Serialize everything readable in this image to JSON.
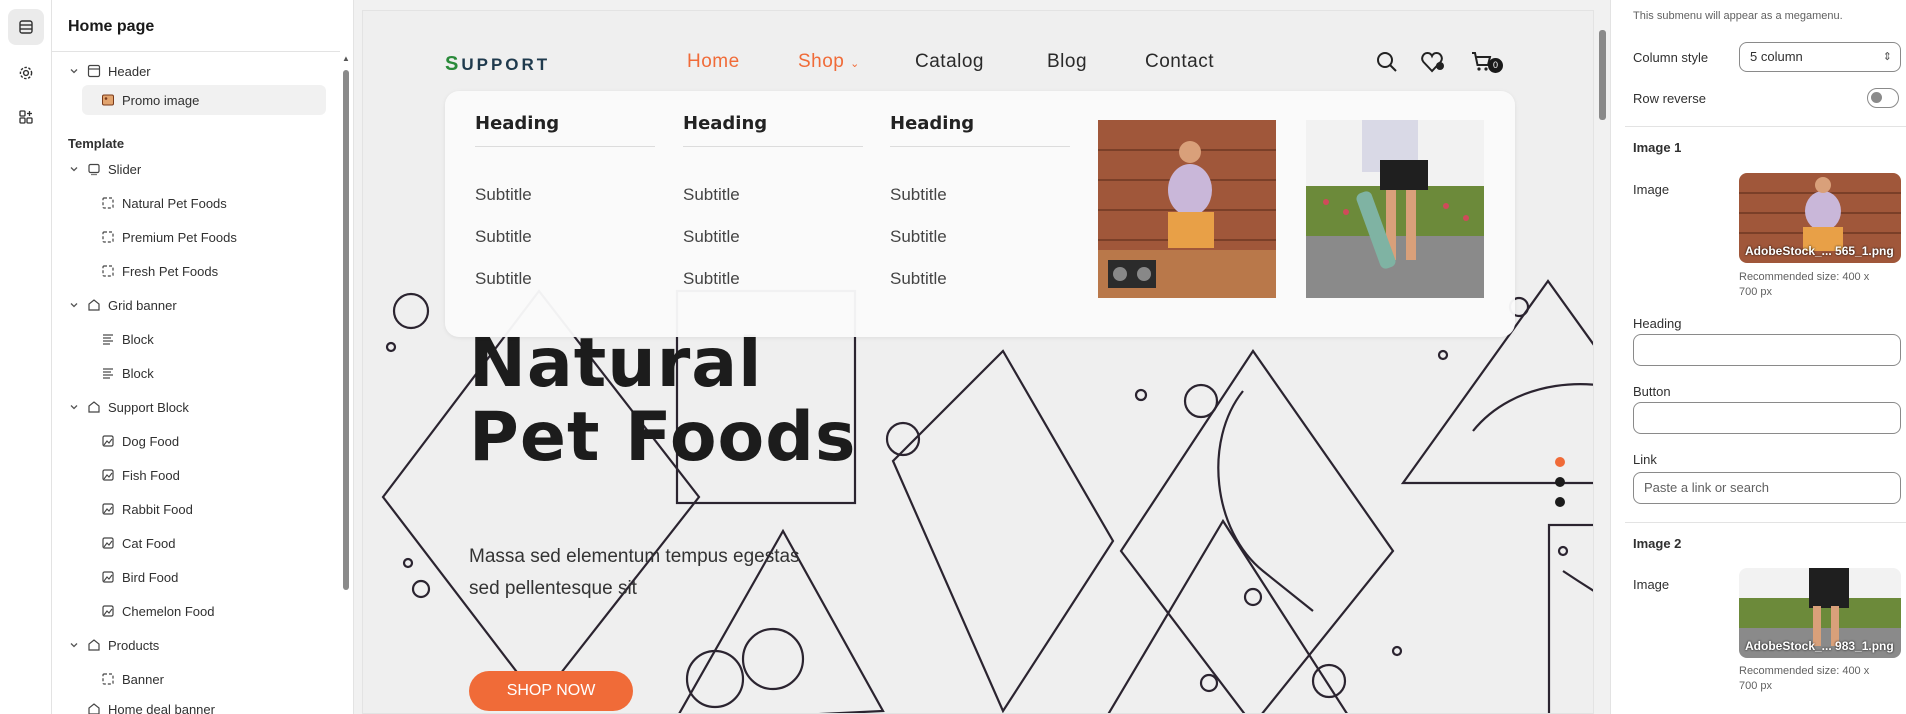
{
  "sidebar": {
    "title": "Home page",
    "header_group": "Header",
    "promo": "Promo image",
    "template_label": "Template",
    "slider": "Slider",
    "slides": [
      "Natural Pet Foods",
      "Premium Pet Foods",
      "Fresh Pet Foods"
    ],
    "grid_banner": "Grid banner",
    "blocks": [
      "Block",
      "Block"
    ],
    "support_block": "Support Block",
    "support_items": [
      "Dog Food",
      "Fish Food",
      "Rabbit Food",
      "Cat Food",
      "Bird Food",
      "Chemelon Food"
    ],
    "products": "Products",
    "banner": "Banner",
    "home_deal": "Home deal banner"
  },
  "preview": {
    "logo": "UPPORT",
    "logo_first": "S",
    "nav": [
      "Home",
      "Shop",
      "Catalog",
      "Blog",
      "Contact"
    ],
    "cart_count": "0",
    "mega_heading": "Heading",
    "mega_subtitle": "Subtitle",
    "hero_title_1": "Natural",
    "hero_title_2": "Pet Foods",
    "hero_text": "Massa sed elementum tempus egestas sed pellentesque sit",
    "shop_btn": "SHOP NOW",
    "accent": "#f06b38"
  },
  "settings": {
    "note": "This submenu will appear as a megamenu.",
    "column_style_label": "Column style",
    "column_style_value": "5 column",
    "row_reverse_label": "Row reverse",
    "row_reverse_on": false,
    "image1_title": "Image 1",
    "image_label": "Image",
    "image1_file": "AdobeStock_... 565_1.png",
    "recommended": "Recommended size: 400 x 700 px",
    "heading_label": "Heading",
    "heading_value": "",
    "button_label": "Button",
    "button_value": "",
    "link_label": "Link",
    "link_placeholder": "Paste a link or search",
    "image2_title": "Image 2",
    "image2_file": "AdobeStock_... 983_1.png"
  }
}
